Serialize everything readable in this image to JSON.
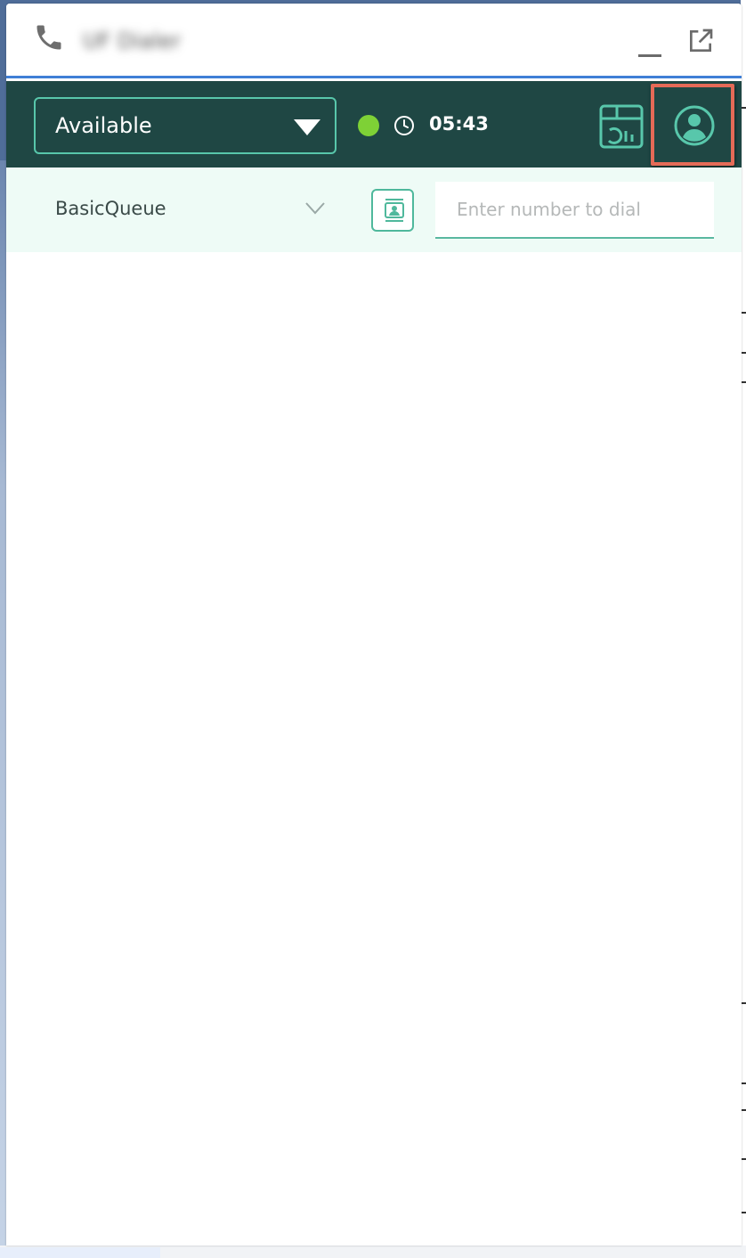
{
  "window": {
    "title": "UF Dialer"
  },
  "toolbar": {
    "status": "Available",
    "status_color": "#7ed136",
    "timer": "05:43"
  },
  "queue": {
    "selected": "BasicQueue"
  },
  "dial": {
    "placeholder": "Enter number to dial",
    "value": ""
  },
  "icons": {
    "phone": "phone-icon",
    "minimize": "minimize-icon",
    "popout": "external-link-icon",
    "clock": "clock-icon",
    "dashboard": "dashboard-icon",
    "profile": "user-circle-icon",
    "contacts": "contact-card-icon",
    "chevron": "chevron-down-icon"
  },
  "colors": {
    "toolbar_bg": "#1f4744",
    "accent": "#58c7ab",
    "highlight": "#e56a57",
    "queue_bg": "#eefbf6",
    "title_border": "#3f7fd6"
  }
}
